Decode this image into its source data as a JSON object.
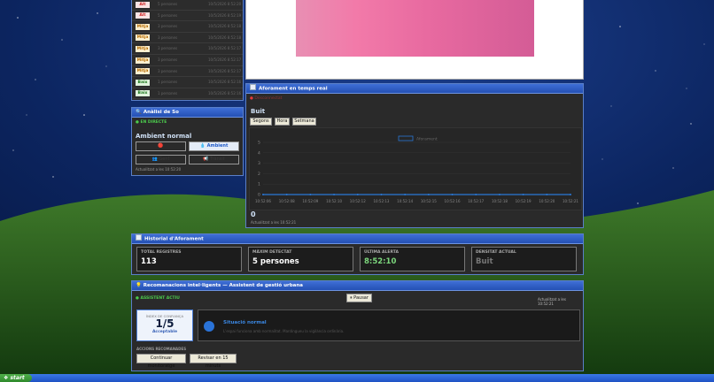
{
  "alerts": [
    {
      "level": "Alt",
      "type": "alt",
      "people": "5 persones",
      "time": "10/5/2026 8:52:20"
    },
    {
      "level": "Alt",
      "type": "alt",
      "people": "5 persones",
      "time": "10/5/2026 8:52:19"
    },
    {
      "level": "Mitja",
      "type": "mitja",
      "people": "3 persones",
      "time": "10/5/2026 8:52:18"
    },
    {
      "level": "Mitja",
      "type": "mitja",
      "people": "3 persones",
      "time": "10/5/2026 8:52:18"
    },
    {
      "level": "Mitja",
      "type": "mitja",
      "people": "3 persones",
      "time": "10/5/2026 8:52:17"
    },
    {
      "level": "Mitja",
      "type": "mitja",
      "people": "3 persones",
      "time": "10/5/2026 8:52:17"
    },
    {
      "level": "Mitja",
      "type": "mitja",
      "people": "3 persones",
      "time": "10/5/2026 8:52:17"
    },
    {
      "level": "Baix",
      "type": "baix",
      "people": "1 persones",
      "time": "10/5/2026 8:52:16"
    },
    {
      "level": "Baix",
      "type": "baix",
      "people": "1 persones",
      "time": "10/5/2026 8:52:16"
    }
  ],
  "sound": {
    "title": "Anàlisi de So",
    "live": "EN DIRECTE",
    "state": "Ambient normal",
    "btn_alert": "Alerta",
    "btn_ambient": "Ambient",
    "btn_people": "Gent",
    "btn_traffic": "Trànsit",
    "updated": "Actualitzat a les 10:52:20"
  },
  "realtime": {
    "title": "Aforament en temps real",
    "status_label": "Desconnectat",
    "level": "Buit",
    "tabs": [
      "Segons",
      "Hora",
      "Setmana"
    ],
    "legend": "Aforament",
    "current": "0",
    "updated": "Actualitzat a les 10:52:21"
  },
  "chart_data": {
    "type": "line",
    "x": [
      "10:52:06",
      "10:52:08",
      "10:52:09",
      "10:52:10",
      "10:52:12",
      "10:52:13",
      "10:52:14",
      "10:52:15",
      "10:52:16",
      "10:52:17",
      "10:52:18",
      "10:52:19",
      "10:52:20",
      "10:52:21"
    ],
    "series": [
      {
        "name": "Aforament",
        "values": [
          0,
          0,
          0,
          0,
          0,
          0,
          0,
          0,
          0,
          0,
          0,
          0,
          0,
          0
        ]
      }
    ],
    "yticks": [
      0,
      1,
      2,
      3,
      4,
      5
    ],
    "ylim": [
      0,
      5
    ],
    "color": "#2a78d6"
  },
  "history": {
    "title": "Historial d'Aforament",
    "stats": [
      {
        "label": "TOTAL REGISTRES",
        "value": "113",
        "color": "#ffffff"
      },
      {
        "label": "MÀXIM DETECTAT",
        "value": "5 persones",
        "color": "#ffffff"
      },
      {
        "label": "ÚLTIMA ALERTA",
        "value": "8:52:10",
        "color": "#7cd67c"
      },
      {
        "label": "DENSITAT ACTUAL",
        "value": "Buit",
        "color": "#777777"
      }
    ]
  },
  "recs": {
    "title": "Recomanacions intel·ligents — Assistent de gestió urbana",
    "active": "ASSISTENT ACTIU",
    "pause": "⏸ Pausar",
    "updated": "Actualitzat a les 10:52:21",
    "conf_label": "ÍNDEX DE CONFIANÇA",
    "conf_value": "1/5",
    "conf_text": "Acceptable",
    "situation": "Situació normal",
    "situation_desc": "L'espai funciona amb normalitat. Mantingueu la vigilància ordinària.",
    "actions_label": "ACCIONS RECOMANADES",
    "actions": [
      "Continuar monitoratge",
      "Revisar en 15 minuts"
    ]
  },
  "taskbar": {
    "start": "start"
  }
}
